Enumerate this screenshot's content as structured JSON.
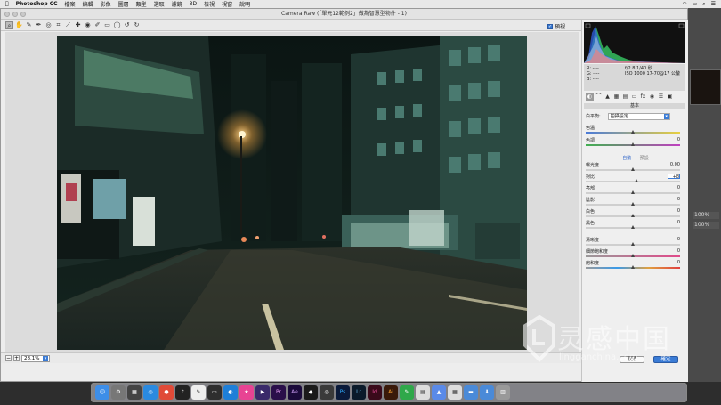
{
  "menubar": {
    "app": "Photoshop CC",
    "items": [
      "檔案",
      "編輯",
      "影像",
      "圖層",
      "類型",
      "選取",
      "濾鏡",
      "3D",
      "檢視",
      "視窗",
      "說明"
    ]
  },
  "dialog": {
    "title": "Camera Raw (「單元12範例2」做為智慧型物件 - 1)",
    "preview_label": "預視",
    "zoom_value": "28.1%",
    "cancel_label": "取消",
    "ok_label": "確定"
  },
  "panel": {
    "readout": {
      "r_label": "R:",
      "g_label": "G:",
      "b_label": "B:",
      "r_value": "----",
      "g_value": "----",
      "b_value": "----",
      "line1": "f/2.8   1/40 秒",
      "line2": "ISO 1000   17-70@17 公釐"
    },
    "section_title": "基本",
    "white_balance_label": "白平衡:",
    "white_balance_value": "拍攝設定",
    "auto_label": "自動",
    "default_label": "預設",
    "sliders": [
      {
        "label": "色溫",
        "value": "",
        "level": 0.5
      },
      {
        "label": "色調",
        "value": "0",
        "level": 0.5
      },
      {
        "label": "曝光度",
        "value": "0.00",
        "level": 0.5
      },
      {
        "label": "對比",
        "value": "+8",
        "level": 0.54
      },
      {
        "label": "亮部",
        "value": "0",
        "level": 0.5
      },
      {
        "label": "陰影",
        "value": "0",
        "level": 0.5
      },
      {
        "label": "白色",
        "value": "0",
        "level": 0.5
      },
      {
        "label": "黑色",
        "value": "0",
        "level": 0.5
      },
      {
        "label": "清晰度",
        "value": "0",
        "level": 0.5
      },
      {
        "label": "細節飽和度",
        "value": "0",
        "level": 0.5
      },
      {
        "label": "飽和度",
        "value": "0",
        "level": 0.5
      }
    ]
  },
  "workspace": {
    "zoom_a": "100%",
    "zoom_b": "100%"
  },
  "watermark": {
    "title": "灵感中国",
    "url": "lingganchina.com"
  },
  "dock": [
    "Finder",
    "Launchpad",
    "Safari",
    "Chrome",
    "Ps",
    "Lr",
    "Id",
    "Ai",
    "Pr",
    "Ae"
  ]
}
